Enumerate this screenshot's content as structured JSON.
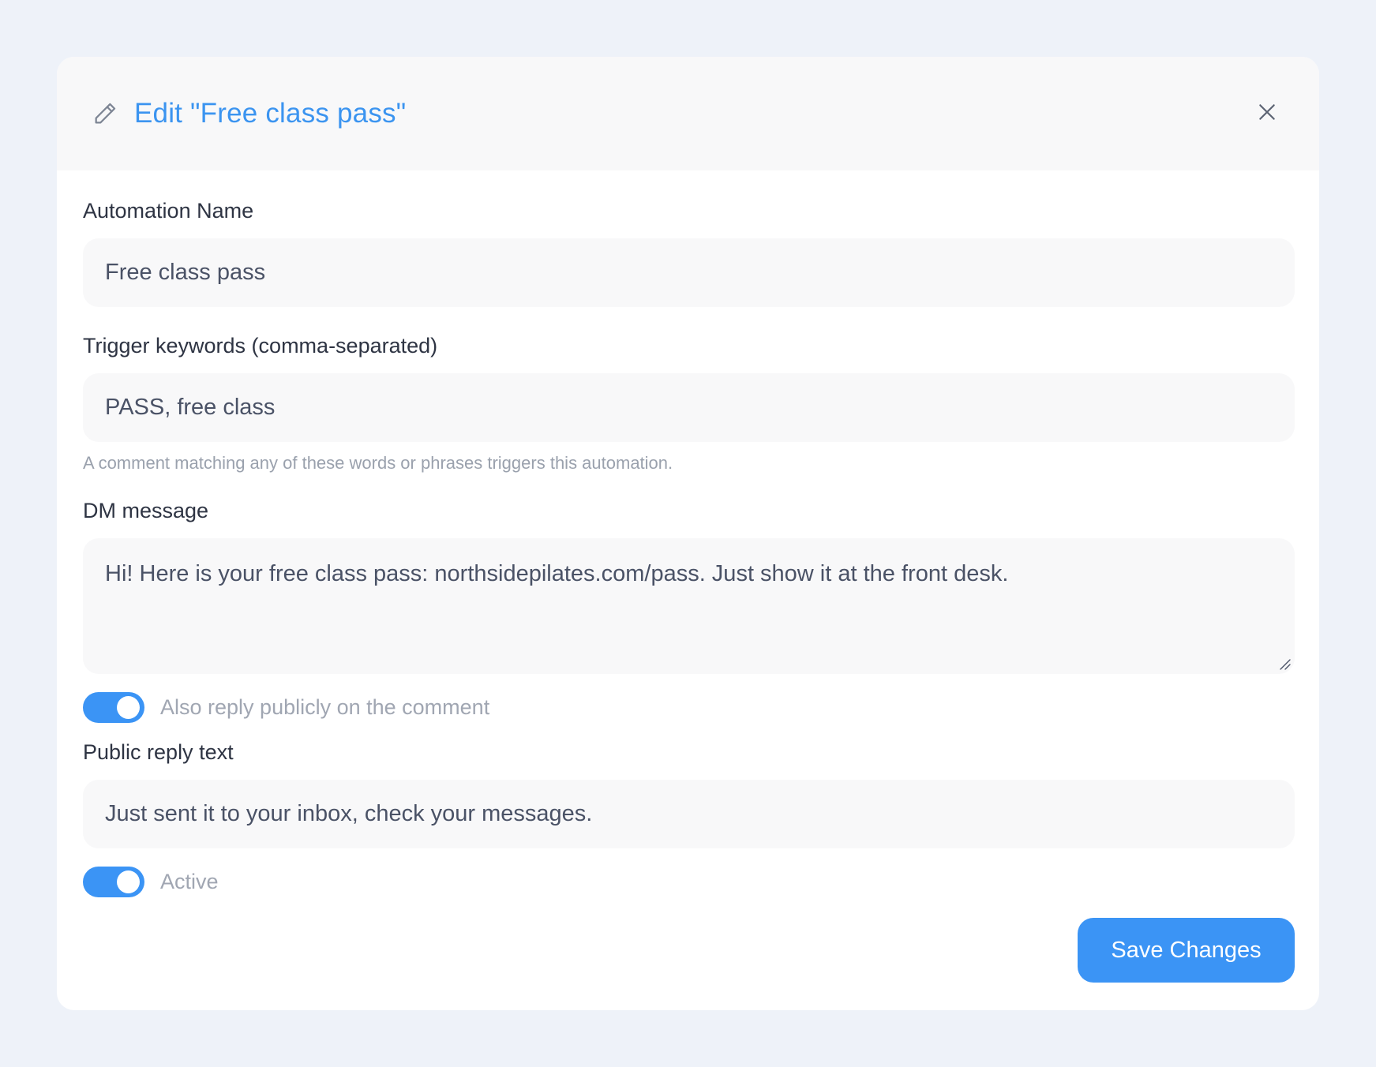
{
  "dialog": {
    "title": "Edit \"Free class pass\"",
    "edit_icon": "pencil-icon",
    "close_icon": "close-icon"
  },
  "form": {
    "automation_name": {
      "label": "Automation Name",
      "value": "Free class pass"
    },
    "trigger_keywords": {
      "label": "Trigger keywords (comma-separated)",
      "value": "PASS, free class",
      "help": "A comment matching any of these words or phrases triggers this automation."
    },
    "dm_message": {
      "label": "DM message",
      "value": "Hi! Here is your free class pass: northsidepilates.com/pass. Just show it at the front desk."
    },
    "public_reply_toggle": {
      "label": "Also reply publicly on the comment",
      "checked": true
    },
    "public_reply_text": {
      "label": "Public reply text",
      "value": "Just sent it to your inbox, check your messages."
    },
    "active_toggle": {
      "label": "Active",
      "checked": true
    }
  },
  "footer": {
    "save_label": "Save Changes"
  },
  "colors": {
    "accent": "#3b94f5",
    "title": "#3b94f0",
    "background": "#eef2f9"
  }
}
